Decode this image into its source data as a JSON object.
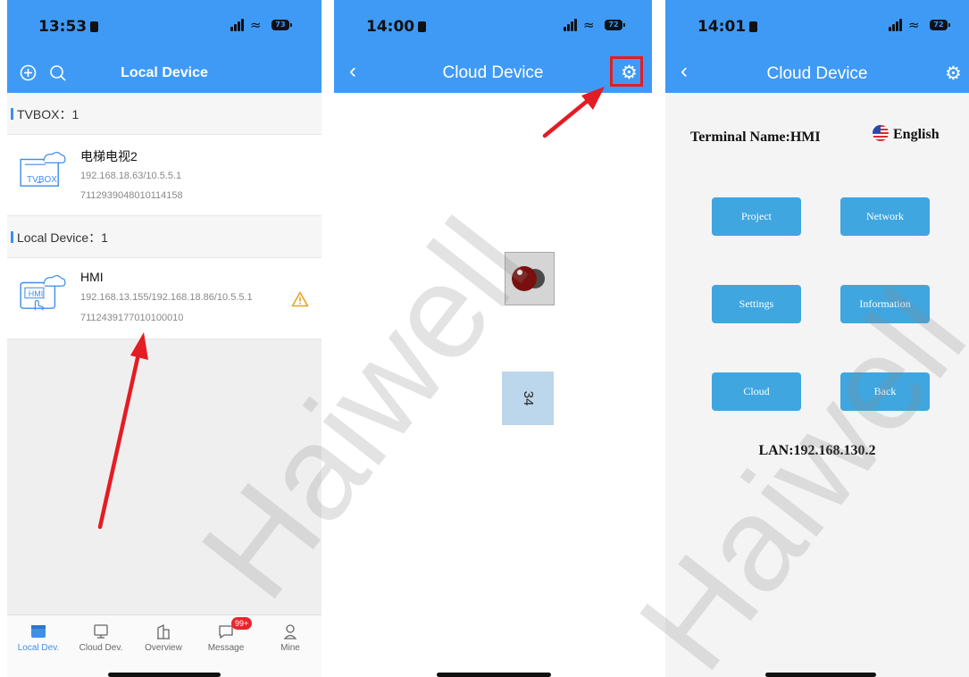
{
  "panel_local": {
    "time": "13:53",
    "battery": "73",
    "title": "Local Device",
    "sections": [
      {
        "heading": "TVBOX：1",
        "device": {
          "icon_label": "TVBOX",
          "name": "电梯电视2",
          "ip": "192.168.18.63/10.5.5.1",
          "serial": "7112939048010114158"
        }
      },
      {
        "heading": "Local Device：1",
        "device": {
          "icon_label": "HMI",
          "name": "HMI",
          "ip": "192.168.13.155/192.168.18.86/10.5.5.1",
          "serial": "7112439177010100010"
        }
      }
    ],
    "tabs": [
      {
        "label": "Local Dev.",
        "icon": "local-device-icon"
      },
      {
        "label": "Cloud Dev.",
        "icon": "monitor-icon"
      },
      {
        "label": "Overview",
        "icon": "building-icon"
      },
      {
        "label": "Message",
        "icon": "chat-icon",
        "badge": "99+"
      },
      {
        "label": "Mine",
        "icon": "person-icon"
      }
    ]
  },
  "panel_cloud": {
    "time": "14:00",
    "battery": "72",
    "title": "Cloud Device",
    "numeric_display": "34"
  },
  "panel_settings": {
    "time": "14:01",
    "battery": "72",
    "title": "Cloud Device",
    "terminal_name": "Terminal Name:HMI",
    "language": "English",
    "buttons": [
      "Project",
      "Network",
      "Settings",
      "Information",
      "Cloud",
      "Back"
    ],
    "lan": "LAN:192.168.130.2"
  },
  "watermark": "Haiwell",
  "colors": {
    "header_blue": "#3f9af6",
    "accent_blue": "#3f8fe8",
    "menu_button": "#40a6df",
    "highlight_red": "#e41c23",
    "badge_red": "#e8262d"
  }
}
